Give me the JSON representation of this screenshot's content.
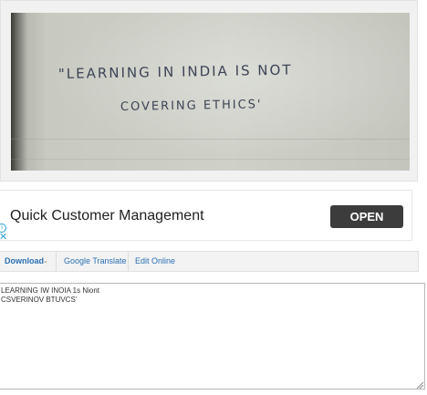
{
  "image": {
    "handwritten_line_1": "\"LEARNING IN INDIA IS NOT",
    "handwritten_line_2": "COVERING ETHICS'"
  },
  "ad": {
    "title": "Quick Customer Management",
    "button_label": "OPEN",
    "info_glyph": "i",
    "close_glyph": "✕",
    "accent_color": "#2a9fd8"
  },
  "toolbar": {
    "download_label": "Download",
    "download_caret": "⌄",
    "translate_label": "Google Translate",
    "edit_label": "Edit Online",
    "link_color": "#2a6fb3"
  },
  "result": {
    "lines": [
      "LEARNING IW INOIA 1s Niont",
      "CSVERINOV BTUVCS'"
    ]
  }
}
